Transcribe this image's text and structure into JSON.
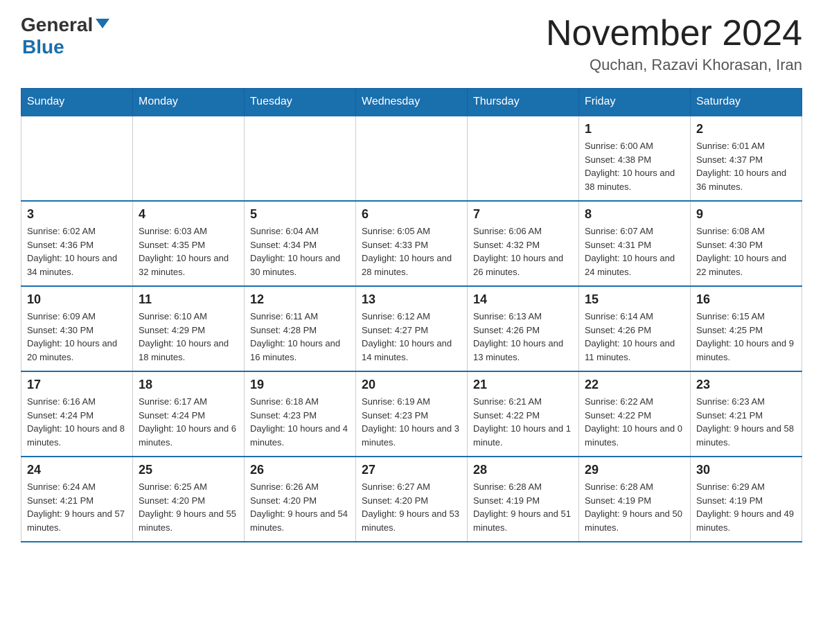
{
  "header": {
    "logo_general": "General",
    "logo_blue": "Blue",
    "month_title": "November 2024",
    "location": "Quchan, Razavi Khorasan, Iran"
  },
  "weekdays": [
    "Sunday",
    "Monday",
    "Tuesday",
    "Wednesday",
    "Thursday",
    "Friday",
    "Saturday"
  ],
  "weeks": [
    [
      {
        "day": "",
        "sunrise": "",
        "sunset": "",
        "daylight": ""
      },
      {
        "day": "",
        "sunrise": "",
        "sunset": "",
        "daylight": ""
      },
      {
        "day": "",
        "sunrise": "",
        "sunset": "",
        "daylight": ""
      },
      {
        "day": "",
        "sunrise": "",
        "sunset": "",
        "daylight": ""
      },
      {
        "day": "",
        "sunrise": "",
        "sunset": "",
        "daylight": ""
      },
      {
        "day": "1",
        "sunrise": "Sunrise: 6:00 AM",
        "sunset": "Sunset: 4:38 PM",
        "daylight": "Daylight: 10 hours and 38 minutes."
      },
      {
        "day": "2",
        "sunrise": "Sunrise: 6:01 AM",
        "sunset": "Sunset: 4:37 PM",
        "daylight": "Daylight: 10 hours and 36 minutes."
      }
    ],
    [
      {
        "day": "3",
        "sunrise": "Sunrise: 6:02 AM",
        "sunset": "Sunset: 4:36 PM",
        "daylight": "Daylight: 10 hours and 34 minutes."
      },
      {
        "day": "4",
        "sunrise": "Sunrise: 6:03 AM",
        "sunset": "Sunset: 4:35 PM",
        "daylight": "Daylight: 10 hours and 32 minutes."
      },
      {
        "day": "5",
        "sunrise": "Sunrise: 6:04 AM",
        "sunset": "Sunset: 4:34 PM",
        "daylight": "Daylight: 10 hours and 30 minutes."
      },
      {
        "day": "6",
        "sunrise": "Sunrise: 6:05 AM",
        "sunset": "Sunset: 4:33 PM",
        "daylight": "Daylight: 10 hours and 28 minutes."
      },
      {
        "day": "7",
        "sunrise": "Sunrise: 6:06 AM",
        "sunset": "Sunset: 4:32 PM",
        "daylight": "Daylight: 10 hours and 26 minutes."
      },
      {
        "day": "8",
        "sunrise": "Sunrise: 6:07 AM",
        "sunset": "Sunset: 4:31 PM",
        "daylight": "Daylight: 10 hours and 24 minutes."
      },
      {
        "day": "9",
        "sunrise": "Sunrise: 6:08 AM",
        "sunset": "Sunset: 4:30 PM",
        "daylight": "Daylight: 10 hours and 22 minutes."
      }
    ],
    [
      {
        "day": "10",
        "sunrise": "Sunrise: 6:09 AM",
        "sunset": "Sunset: 4:30 PM",
        "daylight": "Daylight: 10 hours and 20 minutes."
      },
      {
        "day": "11",
        "sunrise": "Sunrise: 6:10 AM",
        "sunset": "Sunset: 4:29 PM",
        "daylight": "Daylight: 10 hours and 18 minutes."
      },
      {
        "day": "12",
        "sunrise": "Sunrise: 6:11 AM",
        "sunset": "Sunset: 4:28 PM",
        "daylight": "Daylight: 10 hours and 16 minutes."
      },
      {
        "day": "13",
        "sunrise": "Sunrise: 6:12 AM",
        "sunset": "Sunset: 4:27 PM",
        "daylight": "Daylight: 10 hours and 14 minutes."
      },
      {
        "day": "14",
        "sunrise": "Sunrise: 6:13 AM",
        "sunset": "Sunset: 4:26 PM",
        "daylight": "Daylight: 10 hours and 13 minutes."
      },
      {
        "day": "15",
        "sunrise": "Sunrise: 6:14 AM",
        "sunset": "Sunset: 4:26 PM",
        "daylight": "Daylight: 10 hours and 11 minutes."
      },
      {
        "day": "16",
        "sunrise": "Sunrise: 6:15 AM",
        "sunset": "Sunset: 4:25 PM",
        "daylight": "Daylight: 10 hours and 9 minutes."
      }
    ],
    [
      {
        "day": "17",
        "sunrise": "Sunrise: 6:16 AM",
        "sunset": "Sunset: 4:24 PM",
        "daylight": "Daylight: 10 hours and 8 minutes."
      },
      {
        "day": "18",
        "sunrise": "Sunrise: 6:17 AM",
        "sunset": "Sunset: 4:24 PM",
        "daylight": "Daylight: 10 hours and 6 minutes."
      },
      {
        "day": "19",
        "sunrise": "Sunrise: 6:18 AM",
        "sunset": "Sunset: 4:23 PM",
        "daylight": "Daylight: 10 hours and 4 minutes."
      },
      {
        "day": "20",
        "sunrise": "Sunrise: 6:19 AM",
        "sunset": "Sunset: 4:23 PM",
        "daylight": "Daylight: 10 hours and 3 minutes."
      },
      {
        "day": "21",
        "sunrise": "Sunrise: 6:21 AM",
        "sunset": "Sunset: 4:22 PM",
        "daylight": "Daylight: 10 hours and 1 minute."
      },
      {
        "day": "22",
        "sunrise": "Sunrise: 6:22 AM",
        "sunset": "Sunset: 4:22 PM",
        "daylight": "Daylight: 10 hours and 0 minutes."
      },
      {
        "day": "23",
        "sunrise": "Sunrise: 6:23 AM",
        "sunset": "Sunset: 4:21 PM",
        "daylight": "Daylight: 9 hours and 58 minutes."
      }
    ],
    [
      {
        "day": "24",
        "sunrise": "Sunrise: 6:24 AM",
        "sunset": "Sunset: 4:21 PM",
        "daylight": "Daylight: 9 hours and 57 minutes."
      },
      {
        "day": "25",
        "sunrise": "Sunrise: 6:25 AM",
        "sunset": "Sunset: 4:20 PM",
        "daylight": "Daylight: 9 hours and 55 minutes."
      },
      {
        "day": "26",
        "sunrise": "Sunrise: 6:26 AM",
        "sunset": "Sunset: 4:20 PM",
        "daylight": "Daylight: 9 hours and 54 minutes."
      },
      {
        "day": "27",
        "sunrise": "Sunrise: 6:27 AM",
        "sunset": "Sunset: 4:20 PM",
        "daylight": "Daylight: 9 hours and 53 minutes."
      },
      {
        "day": "28",
        "sunrise": "Sunrise: 6:28 AM",
        "sunset": "Sunset: 4:19 PM",
        "daylight": "Daylight: 9 hours and 51 minutes."
      },
      {
        "day": "29",
        "sunrise": "Sunrise: 6:28 AM",
        "sunset": "Sunset: 4:19 PM",
        "daylight": "Daylight: 9 hours and 50 minutes."
      },
      {
        "day": "30",
        "sunrise": "Sunrise: 6:29 AM",
        "sunset": "Sunset: 4:19 PM",
        "daylight": "Daylight: 9 hours and 49 minutes."
      }
    ]
  ]
}
